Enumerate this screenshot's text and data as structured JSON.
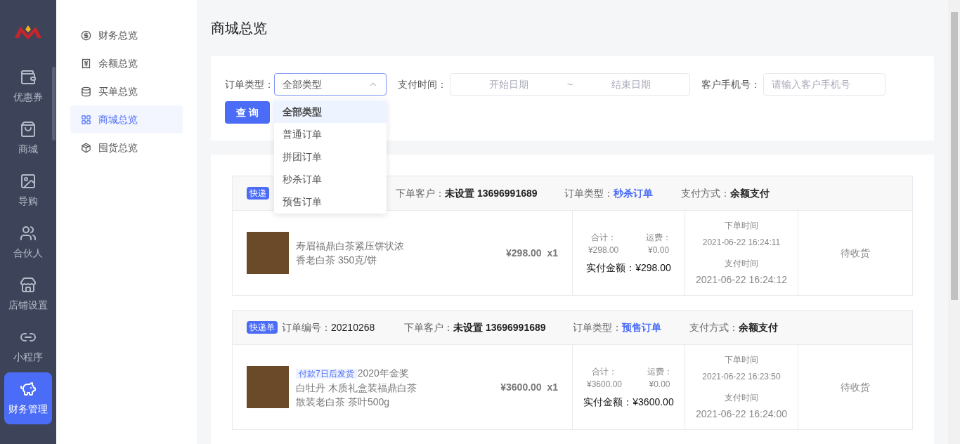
{
  "nav": {
    "items": [
      {
        "label": "优惠券",
        "selected": false
      },
      {
        "label": "商城",
        "selected": false
      },
      {
        "label": "导购",
        "selected": false
      },
      {
        "label": "合伙人",
        "selected": false
      },
      {
        "label": "店铺设置",
        "selected": false
      },
      {
        "label": "小程序",
        "selected": false
      },
      {
        "label": "财务管理",
        "selected": true
      }
    ]
  },
  "submenu": {
    "items": [
      {
        "label": "财务总览",
        "selected": false
      },
      {
        "label": "余额总览",
        "selected": false
      },
      {
        "label": "买单总览",
        "selected": false
      },
      {
        "label": "商城总览",
        "selected": true
      },
      {
        "label": "囤货总览",
        "selected": false
      }
    ]
  },
  "page_title": "商城总览",
  "filters": {
    "order_type": {
      "label": "订单类型：",
      "value": "全部类型",
      "open": true,
      "options": [
        {
          "label": "全部类型",
          "selected": true
        },
        {
          "label": "普通订单",
          "selected": false
        },
        {
          "label": "拼团订单",
          "selected": false
        },
        {
          "label": "秒杀订单",
          "selected": false
        },
        {
          "label": "预售订单",
          "selected": false
        }
      ]
    },
    "pay_time": {
      "label": "支付时间：",
      "start_placeholder": "开始日期",
      "separator": "~",
      "end_placeholder": "结束日期"
    },
    "phone": {
      "label": "客户手机号：",
      "placeholder": "请输入客户手机号"
    },
    "query_button": "查 询"
  },
  "orders": [
    {
      "badge": "快递",
      "customer_label": "下单客户：",
      "customer": "未设置 13696991689",
      "type_label": "订单类型：",
      "type": "秒杀订单",
      "pay_label": "支付方式：",
      "pay": "余额支付",
      "product": {
        "lines": [
          "寿眉福鼎白茶紧压饼状浓",
          "香老白茶 350克/饼"
        ],
        "price": "¥298.00",
        "qty": "x1"
      },
      "total_label": "合计：",
      "total": "¥298.00",
      "shipping_label": "运费：",
      "shipping": "¥0.00",
      "paid_label": "实付金额：",
      "paid": "¥298.00",
      "order_time_label": "下单时间",
      "order_time": "2021-06-22 16:24:11",
      "pay_time_label": "支付时间",
      "pay_time": "2021-06-22 16:24:12",
      "status": "待收货"
    },
    {
      "badge": "快递单",
      "order_no_label": "订单编号：",
      "order_no": "20210268",
      "customer_label": "下单客户：",
      "customer": "未设置 13696991689",
      "type_label": "订单类型：",
      "type": "预售订单",
      "pay_label": "支付方式：",
      "pay": "余额支付",
      "product": {
        "tag": "付款7日后发货",
        "lines": [
          "2020年金奖",
          "白牡丹 木质礼盒装福鼎白茶",
          "散装老白茶 茶叶500g"
        ],
        "price": "¥3600.00",
        "qty": "x1"
      },
      "total_label": "合计：",
      "total": "¥3600.00",
      "shipping_label": "运费：",
      "shipping": "¥0.00",
      "paid_label": "实付金额：",
      "paid": "¥3600.00",
      "order_time_label": "下单时间",
      "order_time": "2021-06-22 16:23:50",
      "pay_time_label": "支付时间",
      "pay_time": "2021-06-22 16:24:00",
      "status": "待收货"
    }
  ]
}
